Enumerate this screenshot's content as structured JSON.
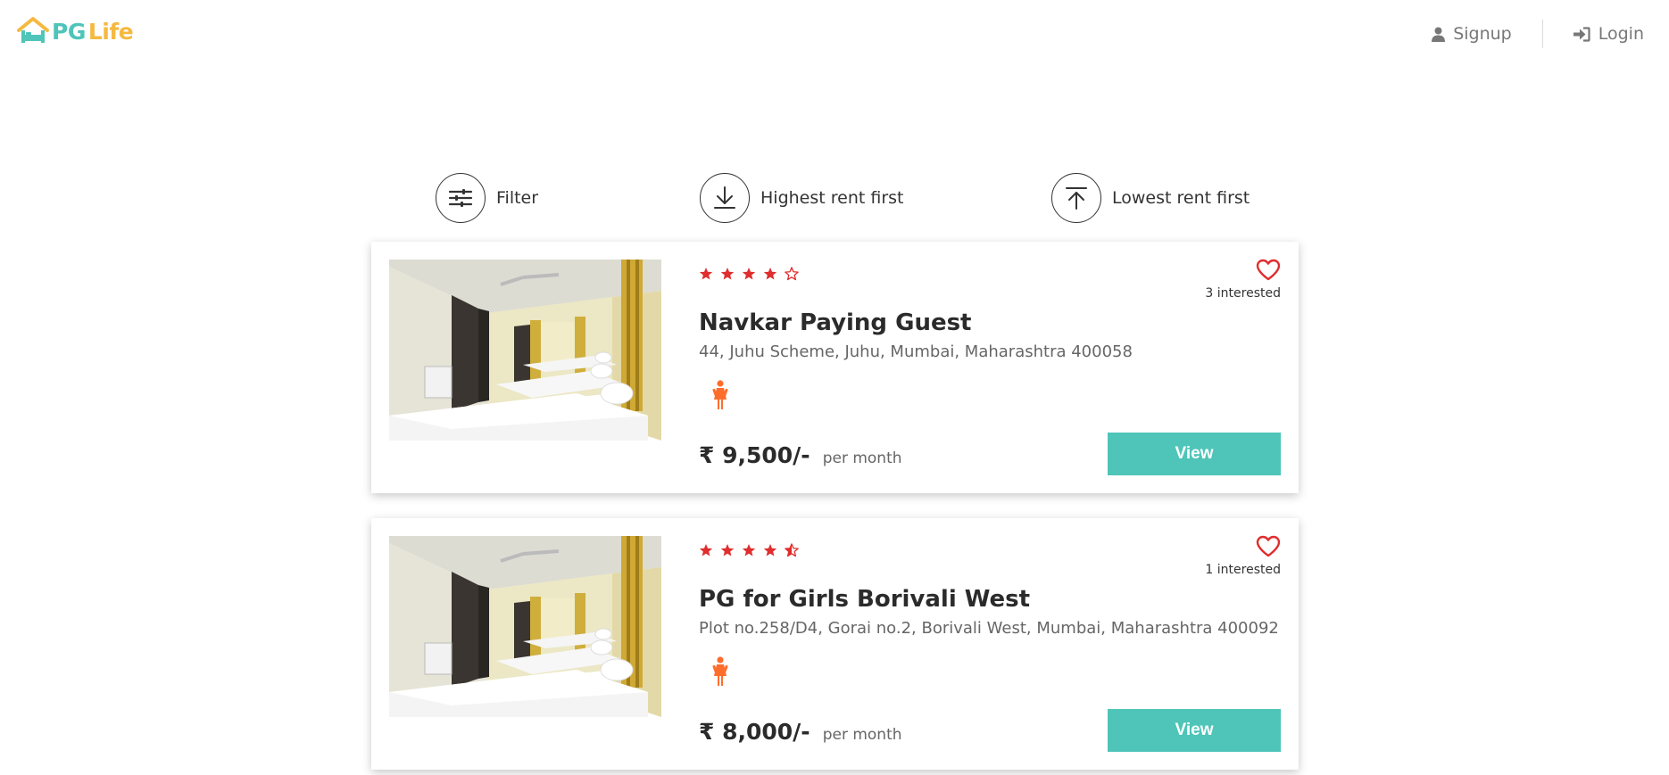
{
  "header": {
    "logo": {
      "pg": "PG",
      "life": "Life"
    },
    "nav": {
      "signup": "Signup",
      "login": "Login"
    }
  },
  "sortbar": {
    "filter": "Filter",
    "highest": "Highest rent first",
    "lowest": "Lowest rent first"
  },
  "colors": {
    "accent": "#4ec5b8",
    "logo_yellow": "#f5b940",
    "star_red": "#e02d2d",
    "gender_orange": "#ff6d2d"
  },
  "properties": [
    {
      "rating": 4,
      "interested": "3 interested",
      "name": "Navkar Paying Guest",
      "address": "44, Juhu Scheme, Juhu, Mumbai, Maharashtra 400058",
      "gender_icon": "female-icon",
      "rent": "₹ 9,500/-",
      "rent_unit": "per month",
      "view_label": "View"
    },
    {
      "rating": 4.5,
      "interested": "1 interested",
      "name": "PG for Girls Borivali West",
      "address": "Plot no.258/D4, Gorai no.2, Borivali West, Mumbai, Maharashtra 400092",
      "gender_icon": "female-icon",
      "rent": "₹ 8,000/-",
      "rent_unit": "per month",
      "view_label": "View"
    }
  ]
}
